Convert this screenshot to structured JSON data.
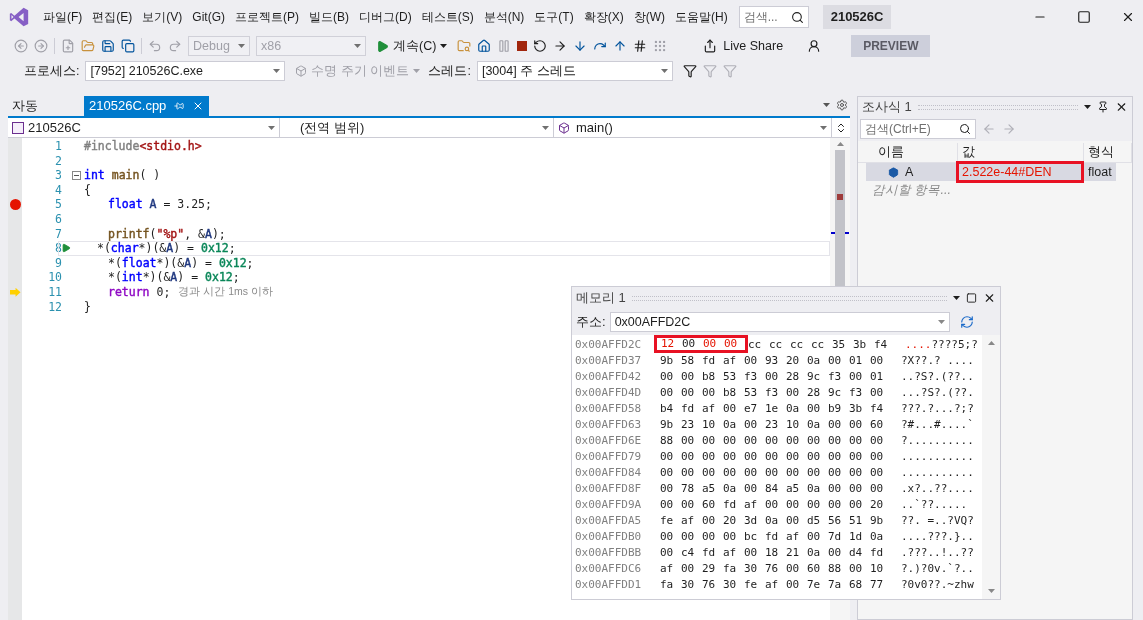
{
  "menu": [
    "파일(F)",
    "편집(E)",
    "보기(V)",
    "Git(G)",
    "프로젝트(P)",
    "빌드(B)",
    "디버그(D)",
    "테스트(S)",
    "분석(N)",
    "도구(T)",
    "확장(X)",
    "창(W)",
    "도움말(H)"
  ],
  "search": {
    "placeholder": "검색..."
  },
  "solution_title": "210526C",
  "toolbar": {
    "config": {
      "value": "Debug",
      "disabled": true
    },
    "platform": {
      "value": "x86",
      "disabled": true
    },
    "continue": "계속(C)",
    "live_share": "Live Share",
    "preview": "PREVIEW"
  },
  "debug_location": {
    "process_label": "프로세스:",
    "process": "[7952] 210526C.exe",
    "lifecycle": {
      "label": "수명 주기 이벤트",
      "disabled": true
    },
    "thread_label": "스레드:",
    "thread": "[3004] 주 스레드"
  },
  "tabs": [
    {
      "label": "자동",
      "selected": false
    },
    {
      "label": "210526C.cpp",
      "selected": true
    }
  ],
  "nav_bar": {
    "project": "210526C",
    "scope": "(전역 범위)",
    "member": "main()"
  },
  "code": [
    {
      "number": "1",
      "breakpoint": false,
      "current": false,
      "run_to": false,
      "foldable": false,
      "indented": false,
      "tokens": [
        {
          "t": "#include",
          "color": "#808080",
          "space": false
        },
        {
          "t": "<stdio.h>",
          "color": "#a31515",
          "space": false
        }
      ]
    },
    {
      "number": "2",
      "breakpoint": false,
      "current": false,
      "run_to": false,
      "foldable": false
    },
    {
      "number": "3",
      "breakpoint": false,
      "current": false,
      "run_to": false,
      "foldable": true,
      "indented": false,
      "tokens": [
        {
          "t": "int",
          "color": "#0000ff",
          "space": true
        },
        {
          "t": "main",
          "color": "#74531f",
          "space": false
        },
        {
          "t": "( )",
          "space": false
        }
      ]
    },
    {
      "number": "4",
      "breakpoint": false,
      "current": false,
      "run_to": false,
      "foldable": false,
      "indented": false,
      "tokens": [
        {
          "t": "{",
          "space": false
        }
      ]
    },
    {
      "number": "5",
      "breakpoint": true,
      "current": false,
      "run_to": false,
      "foldable": false,
      "indented": true,
      "tokens": [
        {
          "t": "float",
          "color": "#0000ff",
          "space": true
        },
        {
          "t": "A",
          "color": "#1f377f",
          "space": true
        },
        {
          "t": "= 3.25;",
          "space": false
        }
      ]
    },
    {
      "number": "6",
      "breakpoint": false,
      "current": false,
      "run_to": false,
      "foldable": false
    },
    {
      "number": "7",
      "breakpoint": false,
      "current": false,
      "run_to": false,
      "foldable": false,
      "indented": true,
      "tokens": [
        {
          "t": "printf",
          "color": "#74531f",
          "space": false
        },
        {
          "t": "(",
          "space": false
        },
        {
          "t": "\"%p\"",
          "color": "#a31515",
          "space": false
        },
        {
          "t": ",",
          "space": true
        },
        {
          "t": "&",
          "space": false
        },
        {
          "t": "A",
          "color": "#1f377f",
          "space": false
        },
        {
          "t": ");",
          "space": false
        }
      ]
    },
    {
      "number": "8",
      "breakpoint": false,
      "current": false,
      "run_to": true,
      "foldable": false,
      "indented": true,
      "tokens": [
        {
          "t": "*(",
          "space": false
        },
        {
          "t": "char",
          "color": "#0000ff",
          "space": false
        },
        {
          "t": "*)(&",
          "space": false
        },
        {
          "t": "A",
          "color": "#1f377f",
          "space": false
        },
        {
          "t": ")",
          "space": true
        },
        {
          "t": "=",
          "space": true
        },
        {
          "t": "0x12",
          "color": "#098658",
          "space": false
        },
        {
          "t": ";",
          "space": false
        }
      ]
    },
    {
      "number": "9",
      "breakpoint": false,
      "current": false,
      "run_to": false,
      "foldable": false,
      "indented": true,
      "tokens": [
        {
          "t": "*(",
          "space": false
        },
        {
          "t": "float",
          "color": "#0000ff",
          "space": false
        },
        {
          "t": "*)(&",
          "space": false
        },
        {
          "t": "A",
          "color": "#1f377f",
          "space": false
        },
        {
          "t": ")",
          "space": true
        },
        {
          "t": "=",
          "space": true
        },
        {
          "t": "0x12",
          "color": "#098658",
          "space": false
        },
        {
          "t": ";",
          "space": false
        }
      ]
    },
    {
      "number": "10",
      "breakpoint": false,
      "current": false,
      "run_to": false,
      "foldable": false,
      "indented": true,
      "tokens": [
        {
          "t": "*(",
          "space": false
        },
        {
          "t": "int",
          "color": "#0000ff",
          "space": false
        },
        {
          "t": "*)(&",
          "space": false
        },
        {
          "t": "A",
          "color": "#1f377f",
          "space": false
        },
        {
          "t": ")",
          "space": true
        },
        {
          "t": "=",
          "space": true
        },
        {
          "t": "0x12",
          "color": "#098658",
          "space": false
        },
        {
          "t": ";",
          "space": false
        }
      ]
    },
    {
      "number": "11",
      "breakpoint": false,
      "current": true,
      "run_to": false,
      "foldable": false,
      "indented": true,
      "tokens": [
        {
          "t": "return",
          "color": "#8f08c4",
          "space": true
        },
        {
          "t": "0;",
          "space": false
        }
      ],
      "hint": "경과 시간 1ms 이하"
    },
    {
      "number": "12",
      "breakpoint": false,
      "current": false,
      "run_to": false,
      "foldable": false,
      "indented": false,
      "tokens": [
        {
          "t": "}",
          "space": false
        }
      ]
    }
  ],
  "watch": {
    "title": "조사식 1",
    "search_placeholder": "검색(Ctrl+E)",
    "columns": [
      "이름",
      "값",
      "형식"
    ],
    "rows": [
      {
        "name": "A",
        "value": "2.522e-44#DEN",
        "type": "float",
        "changed": true,
        "highlighted": true
      }
    ],
    "add_placeholder": "감시할 항목..."
  },
  "memory": {
    "title": "메모리 1",
    "address_label": "주소:",
    "address": "0x00AFFD2C",
    "rows": [
      {
        "address": "0x00AFFD2C",
        "bytes": "12 00 00 00 cc cc cc cc 35 3b f4",
        "changed": [
          true,
          false,
          true,
          true,
          false,
          false,
          false,
          false,
          false,
          false,
          false
        ],
        "ascii_changed": "....",
        "ascii": "????5;?"
      },
      {
        "address": "0x00AFFD37",
        "bytes": "9b 58 fd af 00 93 20 0a 00 01 00",
        "ascii": "?X??.? ...."
      },
      {
        "address": "0x00AFFD42",
        "bytes": "00 00 b8 53 f3 00 28 9c f3 00 01",
        "ascii": "..?S?.(??.."
      },
      {
        "address": "0x00AFFD4D",
        "bytes": "00 00 00 b8 53 f3 00 28 9c f3 00",
        "ascii": "...?S?.(??."
      },
      {
        "address": "0x00AFFD58",
        "bytes": "b4 fd af 00 e7 1e 0a 00 b9 3b f4",
        "ascii": "???.?...?;?"
      },
      {
        "address": "0x00AFFD63",
        "bytes": "9b 23 10 0a 00 23 10 0a 00 00 60",
        "ascii": "?#...#....`"
      },
      {
        "address": "0x00AFFD6E",
        "bytes": "88 00 00 00 00 00 00 00 00 00 00",
        "ascii": "?.........."
      },
      {
        "address": "0x00AFFD79",
        "bytes": "00 00 00 00 00 00 00 00 00 00 00",
        "ascii": "..........."
      },
      {
        "address": "0x00AFFD84",
        "bytes": "00 00 00 00 00 00 00 00 00 00 00",
        "ascii": "..........."
      },
      {
        "address": "0x00AFFD8F",
        "bytes": "00 78 a5 0a 00 84 a5 0a 00 00 00",
        "ascii": ".x?..??...."
      },
      {
        "address": "0x00AFFD9A",
        "bytes": "00 00 60 fd af 00 00 00 00 00 20",
        "ascii": "..`??....."
      },
      {
        "address": "0x00AFFDA5",
        "bytes": "fe af 00 20 3d 0a 00 d5 56 51 9b",
        "ascii": "??. =..?VQ?"
      },
      {
        "address": "0x00AFFDB0",
        "bytes": "00 00 00 00 bc fd af 00 7d 1d 0a",
        "ascii": "....???.}.."
      },
      {
        "address": "0x00AFFDBB",
        "bytes": "00 c4 fd af 00 18 21 0a 00 d4 fd",
        "ascii": ".???..!..??"
      },
      {
        "address": "0x00AFFDC6",
        "bytes": "af 00 29 fa 30 76 00 60 88 00 10",
        "ascii": "?.)?0v.`?.."
      },
      {
        "address": "0x00AFFDD1",
        "bytes": "fa 30 76 30 fe af 00 7e 7a 68 77",
        "ascii": "?0v0??.~zhw"
      }
    ]
  }
}
